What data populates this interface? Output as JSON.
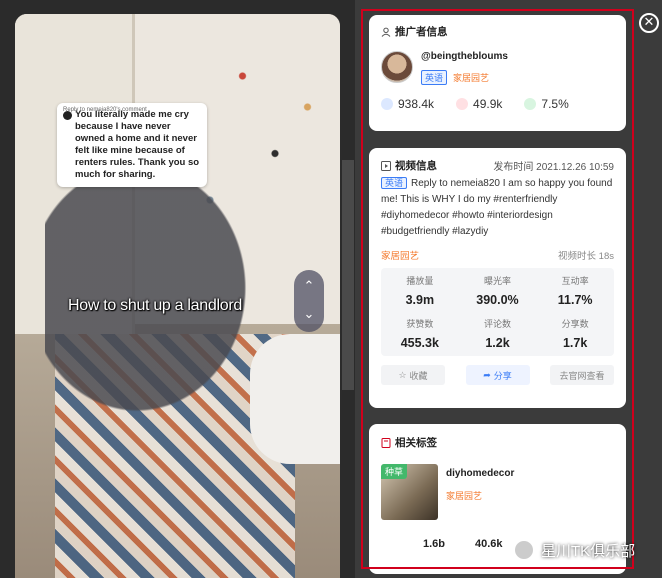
{
  "video": {
    "reply_label": "Reply to nemeia820's comment",
    "comment_text": "You literally made me cry because I have never owned a home and it never felt like mine because of renters rules. Thank you so much for sharing.",
    "caption": "How to shut up a landlord"
  },
  "influencer": {
    "title": "推广者信息",
    "handle": "@beingthebloums",
    "language_tag": "英语",
    "category": "家居园艺",
    "followers": "938.4k",
    "likes": "49.9k",
    "engagement": "7.5%"
  },
  "video_info": {
    "title": "视频信息",
    "publish_label": "发布时间",
    "publish_time": "2021.12.26 10:59",
    "language_tag": "英语",
    "description": "Reply to nemeia820 I am so happy you found me! This is WHY I do my #renterfriendly #diyhomedecor #howto #interiordesign #budgetfriendly #lazydiy",
    "category": "家居园艺",
    "duration_label": "视频时长",
    "duration": "18s",
    "metrics": [
      {
        "label": "播放量",
        "value": "3.9m"
      },
      {
        "label": "曝光率",
        "value": "390.0%"
      },
      {
        "label": "互动率",
        "value": "11.7%"
      },
      {
        "label": "获赞数",
        "value": "455.3k"
      },
      {
        "label": "评论数",
        "value": "1.2k"
      },
      {
        "label": "分享数",
        "value": "1.7k"
      }
    ],
    "actions": {
      "collect": "收藏",
      "share": "分享",
      "view_origin": "去官网查看"
    }
  },
  "related_tags": {
    "title": "相关标签",
    "badge": "种草",
    "tag_name": "diyhomedecor",
    "category": "家居园艺",
    "stat1": "1.6b",
    "stat2": "40.6k"
  },
  "watermark": "星川TK俱乐部",
  "colors": {
    "accent_blue": "#3b7cf6",
    "category_orange": "#f47a2e",
    "frame_red": "#d1001c",
    "badge_green": "#43b86b"
  }
}
